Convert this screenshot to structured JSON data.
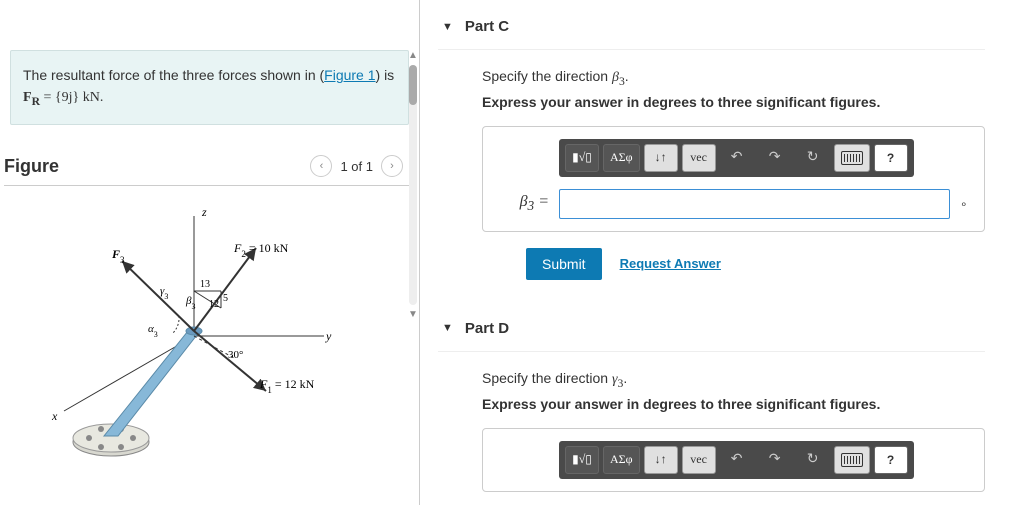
{
  "problem": {
    "prefix": "The resultant force of the three forces shown in (",
    "figureLinkText": "Figure 1",
    "suffix": ") is",
    "equation_lhs": "F",
    "equation_sub": "R",
    "equation_rhs": " = {9j} kN."
  },
  "figure": {
    "title": "Figure",
    "navText": "1 of 1",
    "labels": {
      "z": "z",
      "y": "y",
      "x": "x",
      "F3": "F",
      "F3sub": "3",
      "F2": "F",
      "F2sub": "2",
      "F2val": " = 10 kN",
      "F1": "F",
      "F1sub": "1",
      "F1val": " = 12 kN",
      "angle30": "30°",
      "t13": "13",
      "t5": "5",
      "t12": "12",
      "alpha3": "α",
      "alpha3sub": "3",
      "beta3": "β",
      "beta3sub": "3",
      "gamma3": "γ",
      "gamma3sub": "3"
    }
  },
  "partC": {
    "title": "Part C",
    "question_pre": "Specify the direction ",
    "question_var": "β",
    "question_sub": "3",
    "question_post": ".",
    "instruction": "Express your answer in degrees to three significant figures.",
    "varLabel": "β",
    "varSub": "3",
    "equals": " =",
    "unit": "∘"
  },
  "partD": {
    "title": "Part D",
    "question_pre": "Specify the direction ",
    "question_var": "γ",
    "question_sub": "3",
    "question_post": ".",
    "instruction": "Express your answer in degrees to three significant figures."
  },
  "common": {
    "submit": "Submit",
    "requestAnswer": "Request Answer",
    "toolbar": {
      "template": "▮√▯",
      "greek": "ΑΣφ",
      "subsup": "↓↑",
      "vec": "vec",
      "undo": "↶",
      "redo": "↷",
      "reset": "↻",
      "help": "?"
    }
  }
}
